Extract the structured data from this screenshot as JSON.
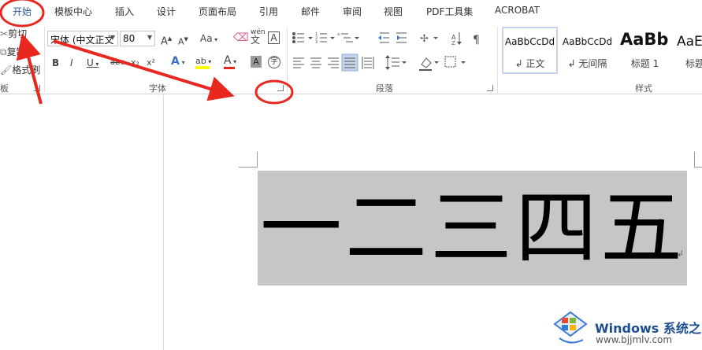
{
  "tabs": [
    "开始",
    "模板中心",
    "插入",
    "设计",
    "页面布局",
    "引用",
    "邮件",
    "审阅",
    "视图",
    "PDF工具集",
    "ACROBAT"
  ],
  "active_tab": "开始",
  "clipboard": {
    "cut": "剪切",
    "copy": "复制",
    "format_painter": "格式刷",
    "group_label": "板"
  },
  "font": {
    "name": "宋体 (中文正文",
    "size": "80",
    "grow": "A",
    "shrink": "A",
    "case": "Aa",
    "phonetic": "wén",
    "char_border": "A",
    "bold": "B",
    "italic": "I",
    "underline": "U",
    "strike": "abc",
    "subscript": "x₂",
    "superscript": "x²",
    "text_effect": "A",
    "highlight": "ab",
    "font_color": "A",
    "char_shading": "A",
    "enclose": "字",
    "group_label": "字体"
  },
  "paragraph": {
    "group_label": "段落"
  },
  "styles": {
    "group_label": "样式",
    "items": [
      {
        "preview": "AaBbCcDd",
        "name": "↲ 正文"
      },
      {
        "preview": "AaBbCcDd",
        "name": "↲ 无间隔"
      },
      {
        "preview": "AaBb",
        "name": "标题 1"
      },
      {
        "preview": "AaE",
        "name": "标题"
      }
    ]
  },
  "document": {
    "text": "一二三四五",
    "para_mark": "↲"
  },
  "watermark": {
    "brand": "Windows",
    "site_cn": "系统之家",
    "url": "www.bjjmlv.com"
  },
  "colors": {
    "active_tab": "#2b579a",
    "annotation": "#e8281e",
    "highlight": "#ffff00",
    "font_color": "#e8281e",
    "selection": "#c6c6c6"
  }
}
